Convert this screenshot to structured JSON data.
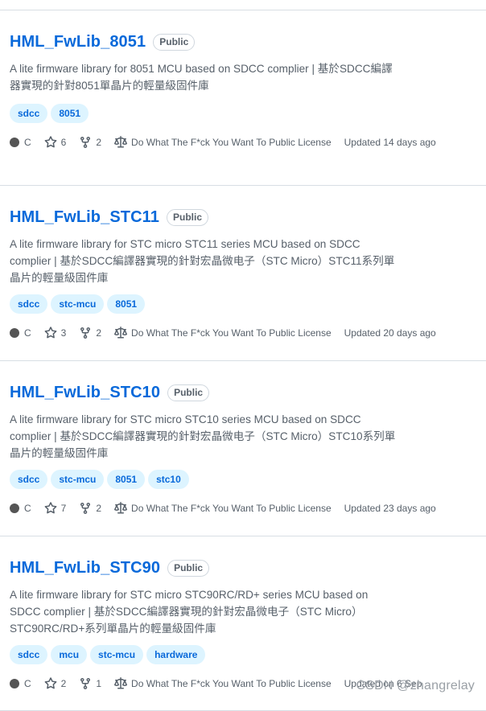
{
  "repos": [
    {
      "name": "HML_FwLib_8051",
      "visibility": "Public",
      "description": "A lite firmware library for 8051 MCU based on SDCC complier | 基於SDCC編譯器實現的針對8051單晶片的輕量級固件庫",
      "topics": [
        "sdcc",
        "8051"
      ],
      "language": "C",
      "stars": "6",
      "forks": "2",
      "license": "Do What The F*ck You Want To Public License",
      "updated": "Updated 14 days ago"
    },
    {
      "name": "HML_FwLib_STC11",
      "visibility": "Public",
      "description": "A lite firmware library for STC micro STC11 series MCU based on SDCC complier | 基於SDCC編譯器實現的針對宏晶微电子（STC Micro）STC11系列單晶片的輕量級固件庫",
      "topics": [
        "sdcc",
        "stc-mcu",
        "8051"
      ],
      "language": "C",
      "stars": "3",
      "forks": "2",
      "license": "Do What The F*ck You Want To Public License",
      "updated": "Updated 20 days ago"
    },
    {
      "name": "HML_FwLib_STC10",
      "visibility": "Public",
      "description": "A lite firmware library for STC micro STC10 series MCU based on SDCC complier | 基於SDCC編譯器實現的針對宏晶微电子（STC Micro）STC10系列單晶片的輕量級固件庫",
      "topics": [
        "sdcc",
        "stc-mcu",
        "8051",
        "stc10"
      ],
      "language": "C",
      "stars": "7",
      "forks": "2",
      "license": "Do What The F*ck You Want To Public License",
      "updated": "Updated 23 days ago"
    },
    {
      "name": "HML_FwLib_STC90",
      "visibility": "Public",
      "description": "A lite firmware library for STC micro STC90RC/RD+ series MCU based on SDCC complier | 基於SDCC編譯器實現的針對宏晶微电子（STC Micro）STC90RC/RD+系列單晶片的輕量級固件庫",
      "topics": [
        "sdcc",
        "mcu",
        "stc-mcu",
        "hardware"
      ],
      "language": "C",
      "stars": "2",
      "forks": "1",
      "license": "Do What The F*ck You Want To Public License",
      "updated": "Updated on 6 Sep"
    }
  ],
  "watermark": "CSDN @zhangrelay",
  "colors": {
    "link": "#0969da",
    "topic_bg": "#ddf4ff",
    "muted": "#57606a",
    "lang_c": "#555555",
    "border": "#d8dee4"
  },
  "icons": {
    "star": "star-icon",
    "fork": "repo-forked-icon",
    "license": "law-icon"
  }
}
